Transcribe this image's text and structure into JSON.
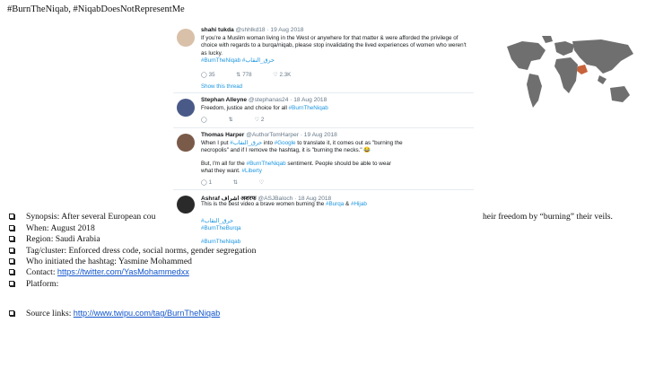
{
  "slide": {
    "title": "#BurnTheNiqab, #NiqabDoesNotRepresentMe"
  },
  "tweets": [
    {
      "name": "shahi tukda",
      "meta": "@shhlkd18 · 19 Aug 2018",
      "text": "If you're a Muslim woman living in the West or anywhere for that matter & were afforded the privilege of choice with regards to a burqa/niqab, please stop invalidating the lived experiences of women who weren't as lucky.",
      "hashtags": "#BurnTheNiqab #حرق_النقاب",
      "replies": "35",
      "retweets": "778",
      "likes": "2.3K",
      "show_thread": "Show this thread"
    },
    {
      "name": "Stephan Alleyne",
      "meta": "@stephanas24 · 18 Aug 2018",
      "text_prefix": "Freedom, justice and choice for all",
      "hashtag": "#BurnTheNiqab",
      "retweets": "",
      "likes": "2"
    },
    {
      "name": "Thomas Harper",
      "meta": "@AuthorTomHarper · 19 Aug 2018",
      "line1_a": "When I put",
      "line1_tag": "#حرق_النقاب",
      "line1_b": "into",
      "line1_tag2": "#Google",
      "line1_c": "to translate it, it comes out as \"burning the",
      "line2": "necropolis\" and if I remove the hashtag, it is \"burning the necks.\" 😂",
      "line3_a": "But, I'm all for the",
      "line3_tag": "#BurnTheNiqab",
      "line3_b": "sentiment. People should be able to wear",
      "line4_a": "what they want.",
      "line4_tag": "#Liberty",
      "replies": "1"
    },
    {
      "name": "Ashraf اشراف अशरफ",
      "meta": "@ASJBaloch · 18 Aug 2018",
      "line1": "This is the best video a brave women burning the",
      "tag_a": "#Burqa",
      "amp": "&",
      "tag_b": "#Hijab",
      "tag_c": "#حرق_النقاب",
      "tag_d": "#BurnTheBurqa",
      "tag_e": "#BurnTheNiqab"
    }
  ],
  "bullets": {
    "synopsis_left": "Synopsis: After several European cou",
    "synopsis_right": "heir freedom by “burning” their veils.",
    "when": "When: August 2018",
    "region": "Region: Saudi Arabia",
    "tag_cluster": "Tag/cluster: Enforced dress code, social norms, gender segregation",
    "initiator": "Who initiated the hashtag:  Yasmine Mohammed",
    "contact_label": "Contact:",
    "contact_link": "https://twitter.com/YasMohammedxx",
    "platform": "Platform:",
    "source_label": "Source links:",
    "source_link": "http://www.twipu.com/tag/BurnTheNiqab"
  },
  "colors": {
    "link": "#1155cc",
    "hashtag": "#1b95e0",
    "map_land": "#6f6f6f",
    "map_highlight": "#c8623a"
  },
  "icons": [
    "reply-icon",
    "retweet-icon",
    "like-icon",
    "world-map-icon"
  ]
}
